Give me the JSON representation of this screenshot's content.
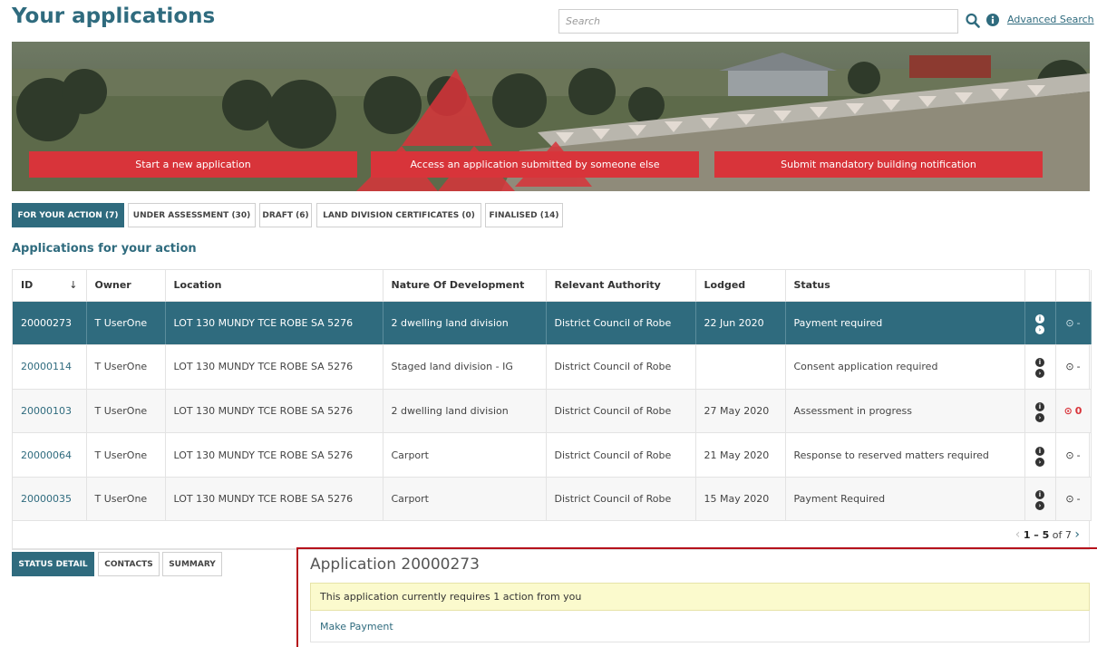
{
  "header": {
    "title": "Your applications",
    "search_placeholder": "Search",
    "advanced_search": "Advanced Search"
  },
  "banner": {
    "buttons": [
      {
        "label": "Start a new application"
      },
      {
        "label": "Access an application submitted by someone else"
      },
      {
        "label": "Submit mandatory building notification"
      }
    ]
  },
  "tabs": [
    {
      "label": "FOR YOUR ACTION (7)",
      "active": true
    },
    {
      "label": "UNDER ASSESSMENT (30)",
      "active": false
    },
    {
      "label": "DRAFT (6)",
      "active": false
    },
    {
      "label": "LAND DIVISION CERTIFICATES (0)",
      "active": false
    },
    {
      "label": "FINALISED (14)",
      "active": false
    }
  ],
  "section_heading": "Applications for your action",
  "table": {
    "columns": [
      "ID",
      "Owner",
      "Location",
      "Nature Of Development",
      "Relevant Authority",
      "Lodged",
      "Status"
    ],
    "rows": [
      {
        "id": "20000273",
        "owner": "T UserOne",
        "location": "LOT 130 MUNDY TCE ROBE SA 5276",
        "nature": "2 dwelling land division",
        "authority": "District Council of Robe",
        "lodged": "22 Jun 2020",
        "status": "Payment required",
        "timer": "-",
        "selected": true
      },
      {
        "id": "20000114",
        "owner": "T UserOne",
        "location": "LOT 130 MUNDY TCE ROBE SA 5276",
        "nature": "Staged land division - IG",
        "authority": "District Council of Robe",
        "lodged": "",
        "status": "Consent application required",
        "timer": "-"
      },
      {
        "id": "20000103",
        "owner": "T UserOne",
        "location": "LOT 130 MUNDY TCE ROBE SA 5276",
        "nature": "2 dwelling land division",
        "authority": "District Council of Robe",
        "lodged": "27 May 2020",
        "status": "Assessment in progress",
        "timer": "0",
        "alert": true
      },
      {
        "id": "20000064",
        "owner": "T UserOne",
        "location": "LOT 130 MUNDY TCE ROBE SA 5276",
        "nature": "Carport",
        "authority": "District Council of Robe",
        "lodged": "21 May 2020",
        "status": "Response to reserved matters required",
        "timer": "-"
      },
      {
        "id": "20000035",
        "owner": "T UserOne",
        "location": "LOT 130 MUNDY TCE ROBE SA 5276",
        "nature": "Carport",
        "authority": "District Council of Robe",
        "lodged": "15 May 2020",
        "status": "Payment Required",
        "timer": "-"
      }
    ],
    "pager": {
      "range": "1 – 5",
      "of": "of 7"
    }
  },
  "detail_tabs": [
    {
      "label": "STATUS DETAIL",
      "active": true
    },
    {
      "label": "CONTACTS",
      "active": false
    },
    {
      "label": "SUMMARY",
      "active": false
    }
  ],
  "detail": {
    "title": "Application 20000273",
    "notice": "This application currently requires 1 action from you",
    "action": "Make Payment"
  },
  "icons": {
    "search": "search-icon",
    "info": "info-icon",
    "sort": "sort-down-arrow-icon",
    "row_info": "info-icon",
    "row_more": "chevron-right-icon",
    "timer": "clock-icon",
    "pager_prev": "chevron-left-icon",
    "pager_next": "chevron-right-icon"
  },
  "colors": {
    "brand": "#2f6b7e",
    "accent": "#d8343a",
    "notice_bg": "#fbfacd",
    "highlight_border": "#b5121b"
  }
}
